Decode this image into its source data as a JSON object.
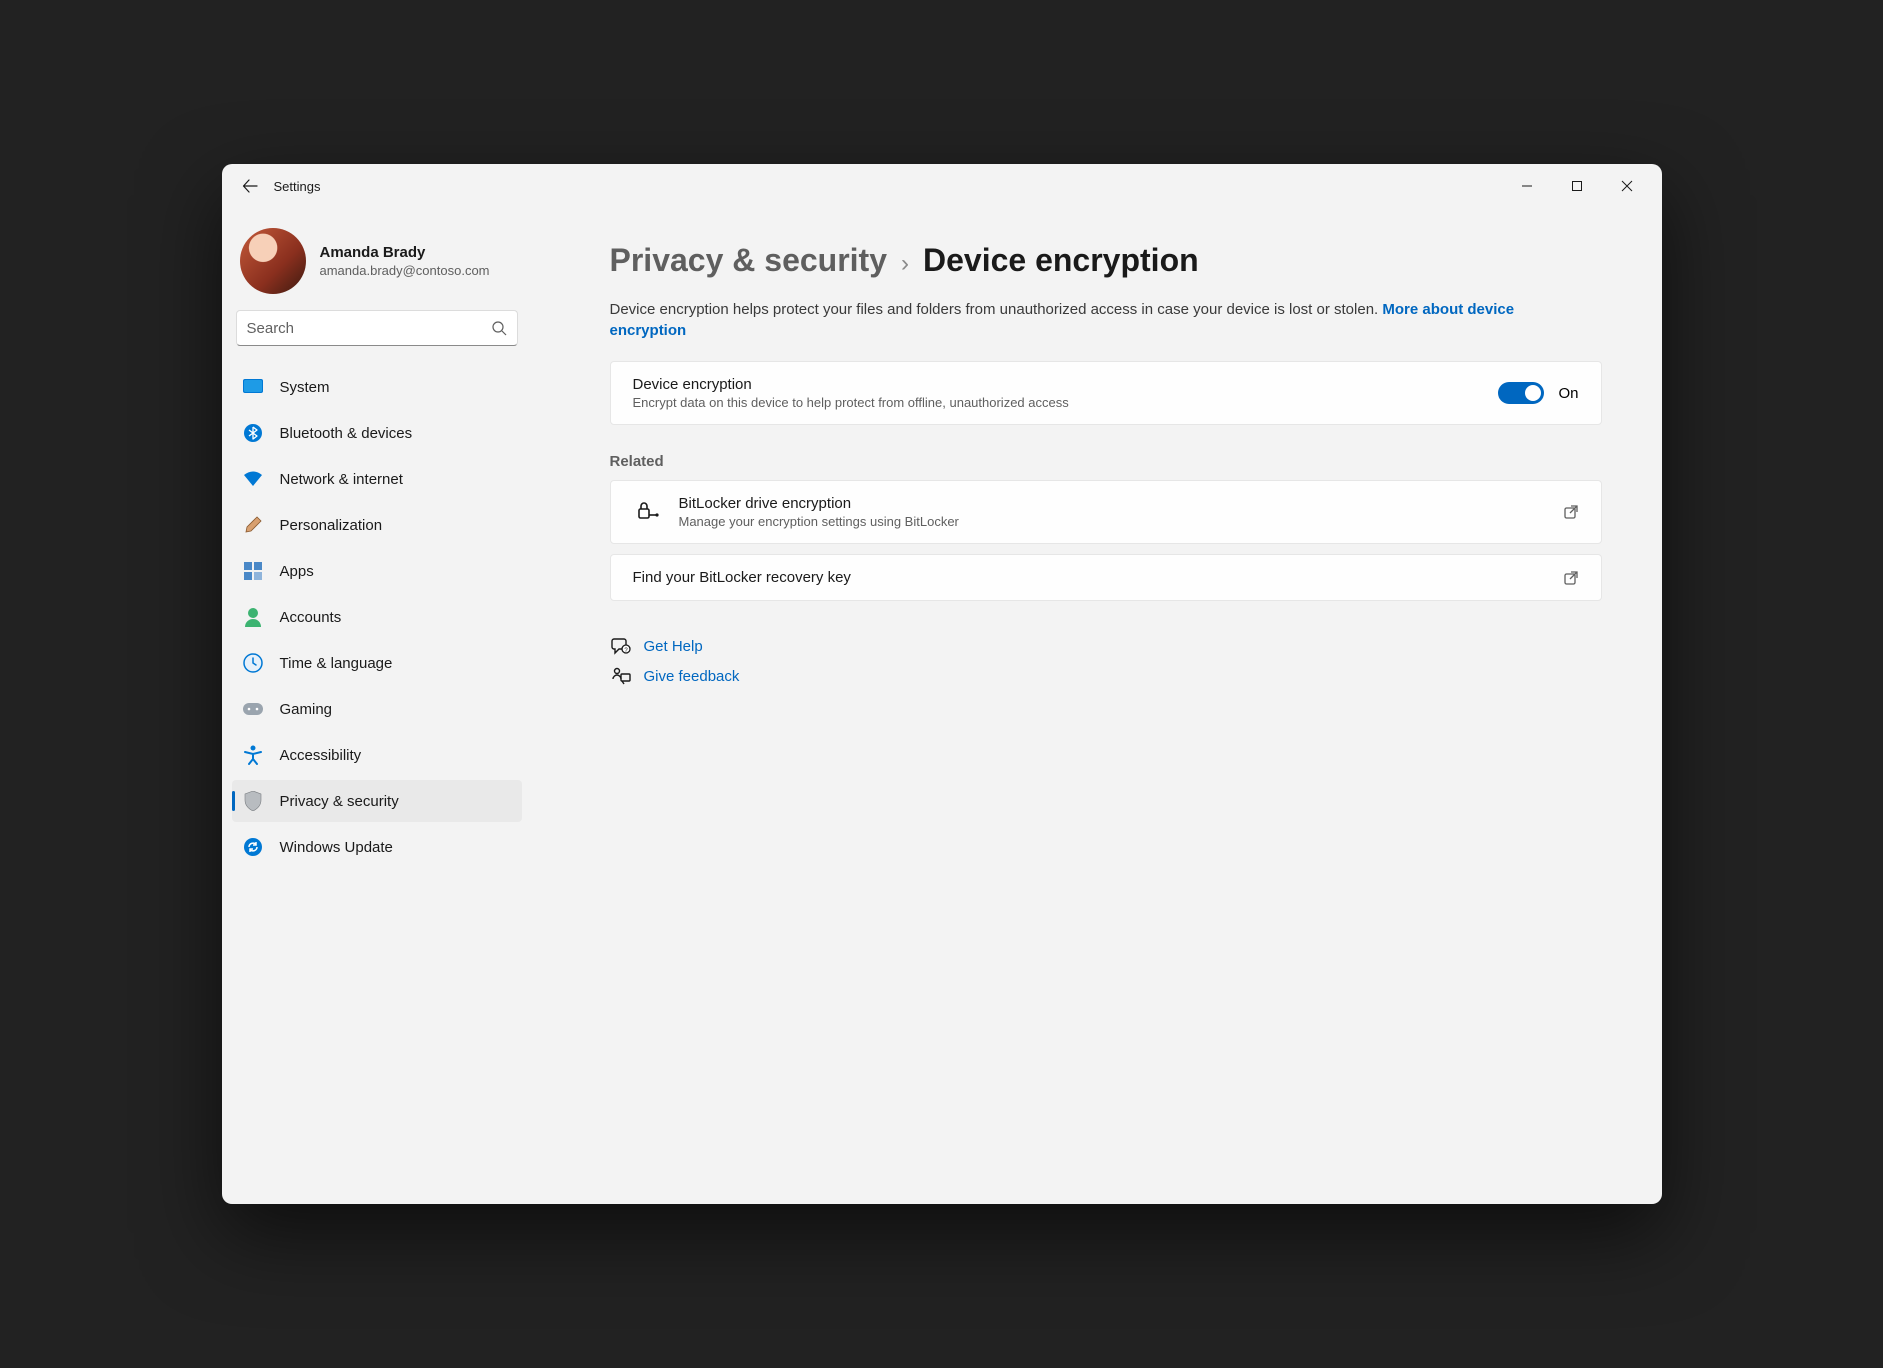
{
  "window": {
    "title": "Settings"
  },
  "user": {
    "name": "Amanda Brady",
    "email": "amanda.brady@contoso.com"
  },
  "search": {
    "placeholder": "Search"
  },
  "sidebar": {
    "items": [
      {
        "label": "System"
      },
      {
        "label": "Bluetooth & devices"
      },
      {
        "label": "Network & internet"
      },
      {
        "label": "Personalization"
      },
      {
        "label": "Apps"
      },
      {
        "label": "Accounts"
      },
      {
        "label": "Time & language"
      },
      {
        "label": "Gaming"
      },
      {
        "label": "Accessibility"
      },
      {
        "label": "Privacy & security"
      },
      {
        "label": "Windows Update"
      }
    ]
  },
  "breadcrumb": {
    "parent": "Privacy & security",
    "current": "Device encryption"
  },
  "description": {
    "text": "Device encryption helps protect your files and folders from unauthorized access in case your device is lost or stolen. ",
    "link": "More about device encryption"
  },
  "encryption_card": {
    "title": "Device encryption",
    "subtitle": "Encrypt data on this device to help protect from offline, unauthorized access",
    "state_label": "On"
  },
  "related": {
    "heading": "Related",
    "items": [
      {
        "title": "BitLocker drive encryption",
        "subtitle": "Manage your encryption settings using BitLocker"
      },
      {
        "title": "Find your BitLocker recovery key"
      }
    ]
  },
  "footer": {
    "help": "Get Help",
    "feedback": "Give feedback"
  }
}
